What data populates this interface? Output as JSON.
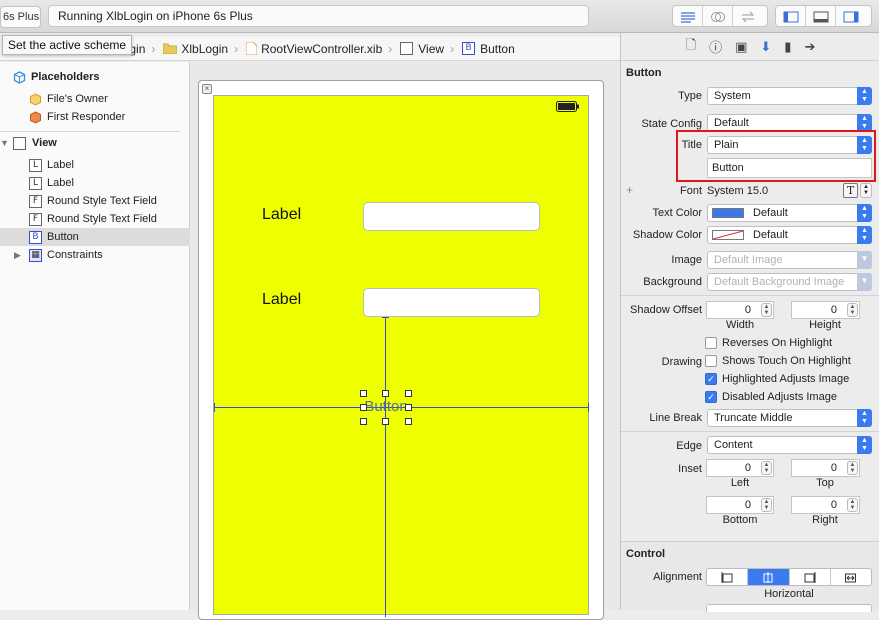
{
  "toolbar": {
    "scheme_device": "6s Plus",
    "activity": "Running XlbLogin on iPhone 6s Plus"
  },
  "tooltip": "Set the active scheme",
  "jumpbar": {
    "items": [
      "Login",
      "XlbLogin",
      "RootViewController.xib",
      "View",
      "Button"
    ]
  },
  "outline": {
    "placeholders": "Placeholders",
    "files_owner": "File's Owner",
    "first_responder": "First Responder",
    "view": "View",
    "items": [
      "Label",
      "Label",
      "Round Style Text Field",
      "Round Style Text Field",
      "Button"
    ],
    "constraints": "Constraints"
  },
  "scene": {
    "label1": "Label",
    "label2": "Label",
    "button": "Button"
  },
  "inspector": {
    "section_button": "Button",
    "type_label": "Type",
    "type_value": "System",
    "state_label": "State Config",
    "state_value": "Default",
    "title_label": "Title",
    "title_value": "Plain",
    "title_text": "Button",
    "font_label": "Font",
    "font_value": "System 15.0",
    "textcolor_label": "Text Color",
    "textcolor_value": "Default",
    "textcolor_swatch": "#3b78e7",
    "shadowcolor_label": "Shadow Color",
    "shadowcolor_value": "Default",
    "image_label": "Image",
    "image_placeholder": "Default Image",
    "background_label": "Background",
    "background_placeholder": "Default Background Image",
    "shadowoffset_label": "Shadow Offset",
    "width_value": "0",
    "height_value": "0",
    "width_label": "Width",
    "height_label": "Height",
    "reverses": "Reverses On Highlight",
    "drawing_label": "Drawing",
    "shows_touch": "Shows Touch On Highlight",
    "highlighted_adjusts": "Highlighted Adjusts Image",
    "disabled_adjusts": "Disabled Adjusts Image",
    "linebreak_label": "Line Break",
    "linebreak_value": "Truncate Middle",
    "edge_label": "Edge",
    "edge_value": "Content",
    "inset_label": "Inset",
    "left_value": "0",
    "top_value": "0",
    "bottom_value": "0",
    "right_value": "0",
    "left_label": "Left",
    "top_label": "Top",
    "bottom_label": "Bottom",
    "right_label": "Right",
    "section_control": "Control",
    "alignment_label": "Alignment",
    "horizontal_label": "Horizontal"
  },
  "colors": {
    "view_bg": "#eeff00",
    "accent": "#3a7cf0",
    "highlight_box": "#e0161c"
  }
}
